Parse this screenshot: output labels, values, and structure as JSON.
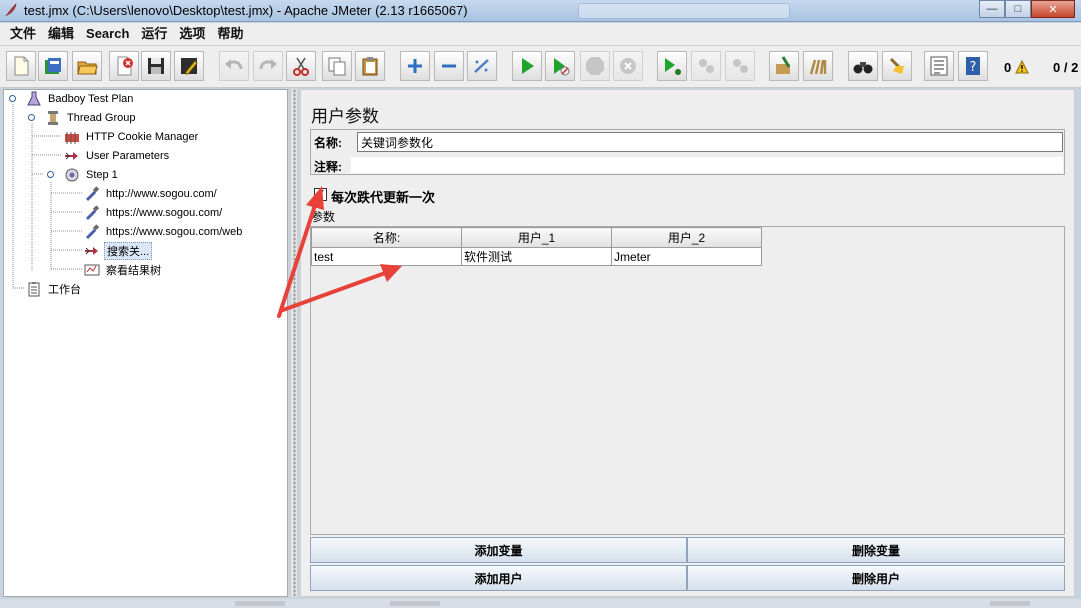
{
  "window": {
    "title": "test.jmx (C:\\Users\\lenovo\\Desktop\\test.jmx) - Apache JMeter (2.13 r1665067)",
    "controls": {
      "minimize": "—",
      "maximize": "□",
      "close": "✕"
    }
  },
  "menubar": [
    "文件",
    "编辑",
    "Search",
    "运行",
    "选项",
    "帮助"
  ],
  "toolbar": {
    "buttons": [
      "new-icon",
      "templates-icon",
      "open-icon",
      "close-file-icon",
      "save-icon",
      "save-as-icon",
      "undo-icon",
      "redo-icon",
      "cut-icon",
      "copy-icon",
      "paste-icon",
      "expand-icon",
      "collapse-icon",
      "toggle-icon",
      "start-icon",
      "start-no-pause-icon",
      "stop-icon",
      "shutdown-icon",
      "remote-start-icon",
      "remote-stop-icon",
      "remote-shutdown-icon",
      "clear-icon",
      "clear-all-icon",
      "search-icon",
      "reset-search-icon",
      "function-helper-icon",
      "help-icon"
    ],
    "warning_count": "0",
    "threads": "0 / 2"
  },
  "tree": {
    "items": [
      {
        "label": "Badboy Test Plan",
        "icon": "test-plan-icon"
      },
      {
        "label": "Thread Group",
        "icon": "thread-group-icon"
      },
      {
        "label": "HTTP Cookie Manager",
        "icon": "cookie-manager-icon"
      },
      {
        "label": "User Parameters",
        "icon": "user-parameters-icon"
      },
      {
        "label": "Step 1",
        "icon": "transaction-controller-icon"
      },
      {
        "label": "http://www.sogou.com/",
        "icon": "http-sampler-icon"
      },
      {
        "label": "https://www.sogou.com/",
        "icon": "http-sampler-icon"
      },
      {
        "label": "https://www.sogou.com/web",
        "icon": "http-sampler-icon"
      },
      {
        "label": "搜索关...",
        "icon": "user-parameters-icon",
        "selected": true
      },
      {
        "label": "察看结果树",
        "icon": "results-tree-icon"
      },
      {
        "label": "工作台",
        "icon": "workbench-icon"
      }
    ]
  },
  "panel": {
    "title": "用户参数",
    "name_label": "名称:",
    "name_value": "关键词参数化",
    "comment_label": "注释:",
    "checkbox_label": "每次跌代更新一次",
    "checkbox_checked": true,
    "checkbox_mark": "✔",
    "params_label": "参数",
    "table": {
      "headers": [
        "名称:",
        "用户_1",
        "用户_2"
      ],
      "rows": [
        [
          "test",
          "软件测试",
          "Jmeter"
        ]
      ]
    },
    "buttons": {
      "add_variable": "添加变量",
      "delete_variable": "删除变量",
      "add_user": "添加用户",
      "delete_user": "删除用户"
    }
  },
  "colors": {
    "annotation_arrow": "#e8413a",
    "selection": "#dbe6f7",
    "title_bar": "#b8cfe9"
  }
}
